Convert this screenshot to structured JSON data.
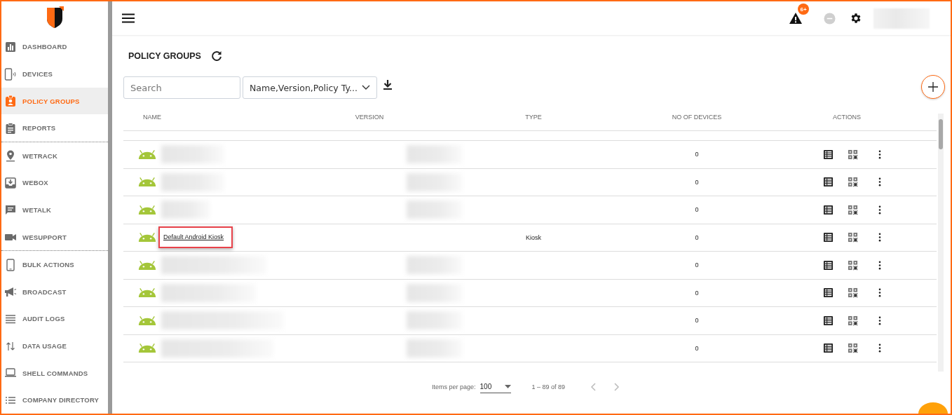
{
  "sidebar": {
    "groups": [
      [
        {
          "label": "DASHBOARD",
          "selected": false
        },
        {
          "label": "DEVICES",
          "selected": false
        },
        {
          "label": "POLICY GROUPS",
          "selected": true
        },
        {
          "label": "REPORTS",
          "selected": false
        }
      ],
      [
        {
          "label": "WETRACK",
          "selected": false
        },
        {
          "label": "WEBOX",
          "selected": false
        },
        {
          "label": "WETALK",
          "selected": false
        },
        {
          "label": "WESUPPORT",
          "selected": false
        }
      ],
      [
        {
          "label": "BULK ACTIONS",
          "selected": false
        },
        {
          "label": "BROADCAST",
          "selected": false
        },
        {
          "label": "AUDIT LOGS",
          "selected": false
        },
        {
          "label": "DATA USAGE",
          "selected": false
        },
        {
          "label": "SHELL COMMANDS",
          "selected": false
        },
        {
          "label": "COMPANY DIRECTORY",
          "selected": false
        }
      ]
    ]
  },
  "topbar": {
    "alert_badge": "6+"
  },
  "page": {
    "title": "POLICY GROUPS",
    "search": {
      "placeholder": "Search"
    },
    "filter": {
      "value": "Name,Version,Policy Ty..."
    }
  },
  "table": {
    "columns": [
      "NAME",
      "VERSION",
      "TYPE",
      "NO OF DEVICES",
      "ACTIONS"
    ],
    "rows": [
      {
        "redacted": true,
        "highlighted": false,
        "devices": "0"
      },
      {
        "redacted": true,
        "highlighted": false,
        "devices": "0"
      },
      {
        "redacted": true,
        "highlighted": false,
        "devices": "0"
      },
      {
        "redacted": false,
        "highlighted": true,
        "name": "Default Android Kiosk",
        "type": "Kiosk",
        "devices": "0"
      },
      {
        "redacted": true,
        "highlighted": false,
        "devices": "0"
      },
      {
        "redacted": true,
        "highlighted": false,
        "devices": "0"
      },
      {
        "redacted": true,
        "highlighted": false,
        "devices": "0"
      },
      {
        "redacted": true,
        "highlighted": false,
        "devices": "0"
      }
    ]
  },
  "paginator": {
    "label": "Items per page:",
    "page_size": "100",
    "range": "1 – 89 of 89"
  }
}
